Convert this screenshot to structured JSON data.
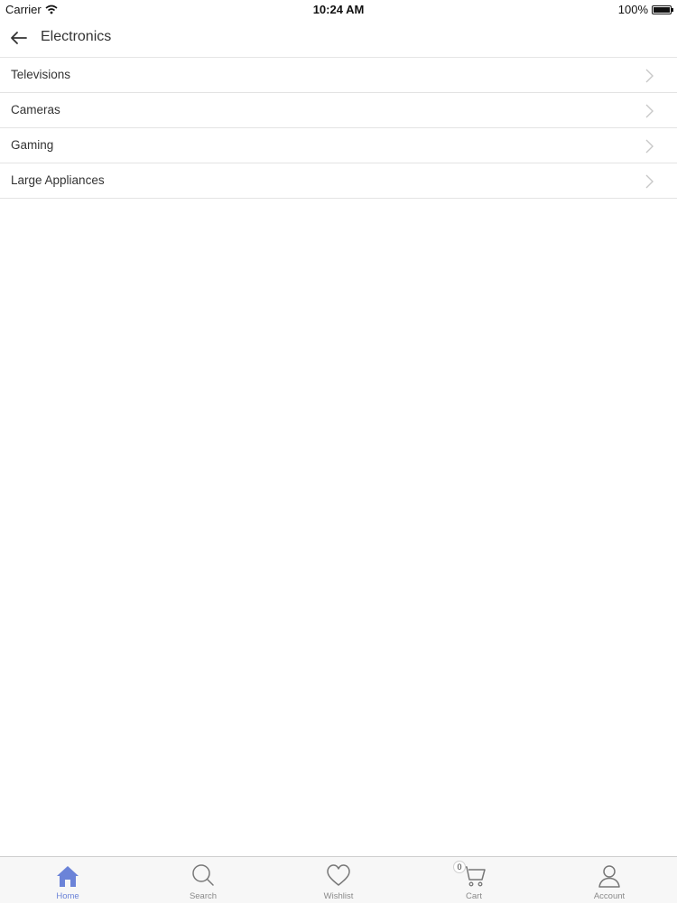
{
  "status_bar": {
    "carrier": "Carrier",
    "time": "10:24 AM",
    "battery": "100%"
  },
  "header": {
    "title": "Electronics"
  },
  "categories": [
    {
      "label": "Televisions"
    },
    {
      "label": "Cameras"
    },
    {
      "label": "Gaming"
    },
    {
      "label": "Large Appliances"
    }
  ],
  "tab_bar": {
    "tabs": [
      {
        "label": "Home",
        "icon": "home-icon",
        "active": true
      },
      {
        "label": "Search",
        "icon": "search-icon",
        "active": false
      },
      {
        "label": "Wishlist",
        "icon": "heart-icon",
        "active": false
      },
      {
        "label": "Cart",
        "icon": "cart-icon",
        "active": false,
        "badge": "0"
      },
      {
        "label": "Account",
        "icon": "user-icon",
        "active": false
      }
    ]
  },
  "colors": {
    "accent": "#6b83d8",
    "inactive": "#8a8a8a",
    "divider": "#e3e3e3"
  }
}
